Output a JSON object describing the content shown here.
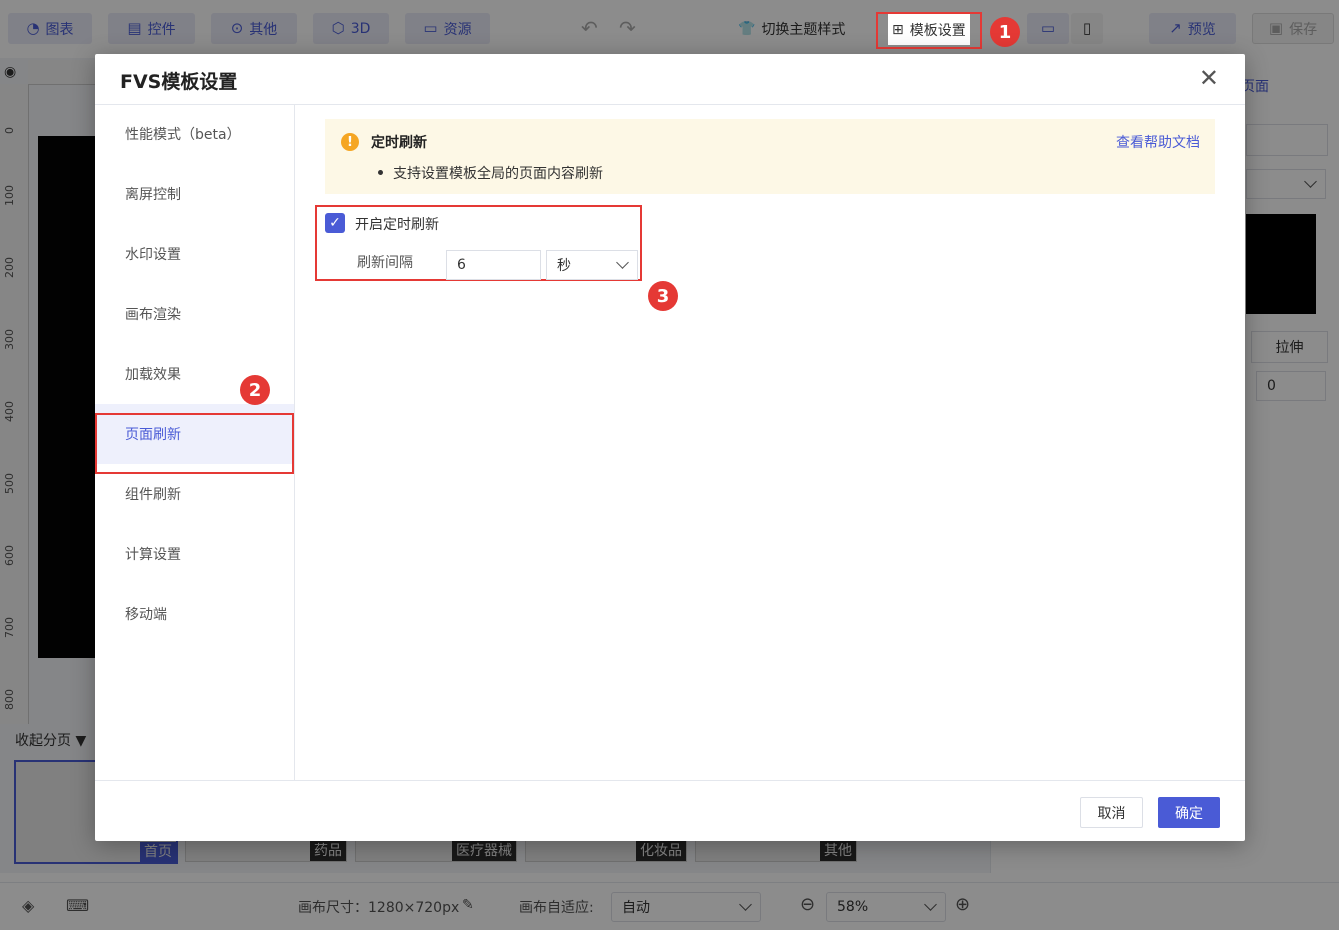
{
  "toolbar": {
    "chart_label": "图表",
    "widget_label": "控件",
    "other_label": "其他",
    "threed_label": "3D",
    "resource_label": "资源",
    "theme_label": "切换主题样式",
    "template_settings_label": "模板设置",
    "preview_label": "预览",
    "save_label": "保存"
  },
  "badges": [
    "1",
    "2",
    "3"
  ],
  "canvas": {
    "ruler_ticks": [
      "0",
      "100",
      "200",
      "300",
      "400",
      "500",
      "600",
      "700",
      "800"
    ],
    "collapse_label": "收起分页"
  },
  "page_tabs": [
    "首页",
    "药品",
    "医疗器械",
    "化妆品",
    "其他"
  ],
  "right_panel": {
    "face_label": "页面",
    "stretch_label": "拉伸",
    "value": "0"
  },
  "bottombar": {
    "canvas_size": "画布尺寸：1280×720px",
    "adapt_label": "画布自适应:",
    "adapt_value": "自动",
    "zoom_value": "58%"
  },
  "modal": {
    "title": "FVS模板设置",
    "nav": [
      {
        "label": "性能模式（beta）"
      },
      {
        "label": "离屏控制"
      },
      {
        "label": "水印设置"
      },
      {
        "label": "画布渲染"
      },
      {
        "label": "加载效果"
      },
      {
        "label": "页面刷新"
      },
      {
        "label": "组件刷新"
      },
      {
        "label": "计算设置"
      },
      {
        "label": "移动端"
      }
    ],
    "active_nav": "页面刷新",
    "notice": {
      "title": "定时刷新",
      "help_link": "查看帮助文档",
      "bullet": "支持设置模板全局的页面内容刷新"
    },
    "enable_refresh": {
      "label": "开启定时刷新",
      "checked": true
    },
    "interval": {
      "label": "刷新间隔",
      "value": "6",
      "unit": "秒"
    },
    "cancel_label": "取消",
    "ok_label": "确定"
  },
  "colors": {
    "accent": "#4a5bd6",
    "highlight_red": "#e53935",
    "notice_bg": "#fdf8e6"
  }
}
